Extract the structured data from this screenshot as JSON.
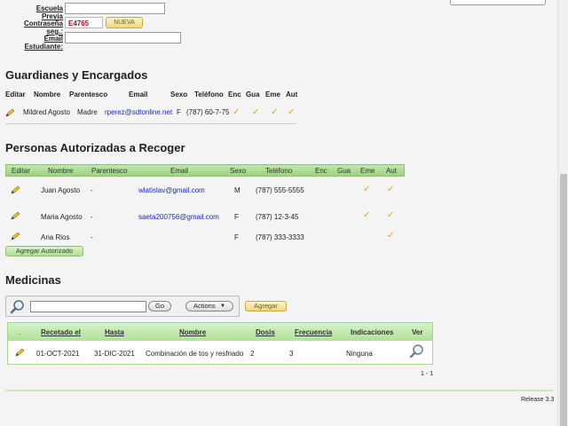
{
  "student_fields": {
    "escuela_previa_label": "Escuela Previa",
    "escuela_previa_value": "",
    "contrasena_label": "Contraseña seg.:",
    "captcha_code": "E4765",
    "nueva_button": "NUEVA",
    "email_label": "Email Estudiante:",
    "email_value": ""
  },
  "guardians": {
    "title": "Guardianes y Encargados",
    "headers": [
      "Editar",
      "Nombre",
      "Parentesco",
      "Email",
      "Sexo",
      "Teléfono",
      "Enc",
      "Gua",
      "Eme",
      "Aut"
    ],
    "rows": [
      {
        "nombre": "Mildred Agosto",
        "parentesco": "Madre",
        "email": "rperez@sdtonline.net",
        "sexo": "F",
        "telefono": "(787) 60-7-75",
        "enc": true,
        "gua": true,
        "eme": true,
        "aut": true
      }
    ]
  },
  "authorized": {
    "title": "Personas Autorizadas a Recoger",
    "headers": [
      "Editar",
      "Nombre",
      "Parentesco",
      "Email",
      "Sexo",
      "Teléfono",
      "Enc",
      "Gua",
      "Eme",
      "Aut"
    ],
    "rows": [
      {
        "nombre": "Juan Agosto",
        "parentesco": "-",
        "email": "wlatislav@gmail.com",
        "sexo": "M",
        "telefono": "(787) 555-5555",
        "eme": true,
        "aut": true
      },
      {
        "nombre": "Maria Agosto",
        "parentesco": "-",
        "email": "saeta200756@gmail.com",
        "sexo": "F",
        "telefono": "(787) 12-3-45",
        "eme": true,
        "aut": true
      },
      {
        "nombre": "Ana Rios",
        "parentesco": "-",
        "email": "",
        "sexo": "F",
        "telefono": "(787) 333-3333",
        "eme": false,
        "aut": true
      }
    ],
    "add_button": "Agregar Autorizado"
  },
  "medicines": {
    "title": "Medicinas",
    "search_value": "",
    "go_button": "Go",
    "actions_button": "Actions",
    "agregar_button": "Agregar",
    "headers": [
      ".",
      "Recetado el",
      "Hasta",
      "Nombre",
      "Dosis",
      "Frecuencia",
      "Indicaciones",
      "Ver"
    ],
    "rows": [
      {
        "recetado": "01-OCT-2021",
        "hasta": "31-DIC-2021",
        "nombre": "Combinación de tos y resfriado",
        "dosis": "2",
        "frecuencia": "3",
        "indicaciones": "Ninguna"
      }
    ],
    "pagination": "1 - 1"
  },
  "footer": {
    "release": "Release 3.3"
  },
  "icons": {
    "edit": "pencil-icon",
    "check": "checkmark-icon",
    "search": "magnifier-icon",
    "view": "magnifier-icon"
  },
  "colors": {
    "header_green": "#9ed184",
    "link_blue": "#1a2ab8",
    "check_gold": "#e0a400",
    "captcha_red": "#d0021b"
  }
}
